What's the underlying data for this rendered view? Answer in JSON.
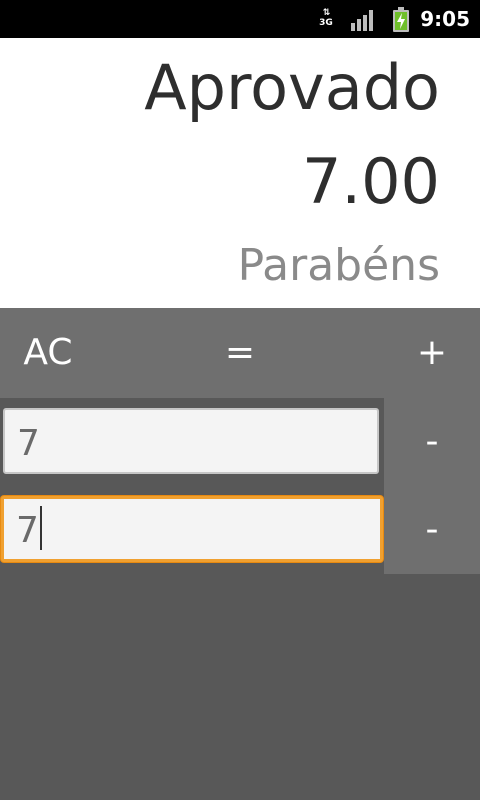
{
  "status_bar": {
    "network_label": "3G",
    "network_icon": "data-arrows-icon",
    "signal_icon": "signal-bars-icon",
    "battery_icon": "battery-charging-icon",
    "time": "9:05"
  },
  "result": {
    "status": "Aprovado",
    "grade": "7.00",
    "message": "Parabéns"
  },
  "keys": {
    "clear": "AC",
    "equals": "=",
    "add": "+",
    "remove_1": "-",
    "remove_2": "-"
  },
  "fields": [
    {
      "value": "7"
    },
    {
      "value": "7"
    }
  ],
  "colors": {
    "status_bar": "#000000",
    "result_bg": "#ffffff",
    "keypad_bg": "#6f6f6f",
    "app_bg": "#585858",
    "focus_border": "#f0a030"
  }
}
